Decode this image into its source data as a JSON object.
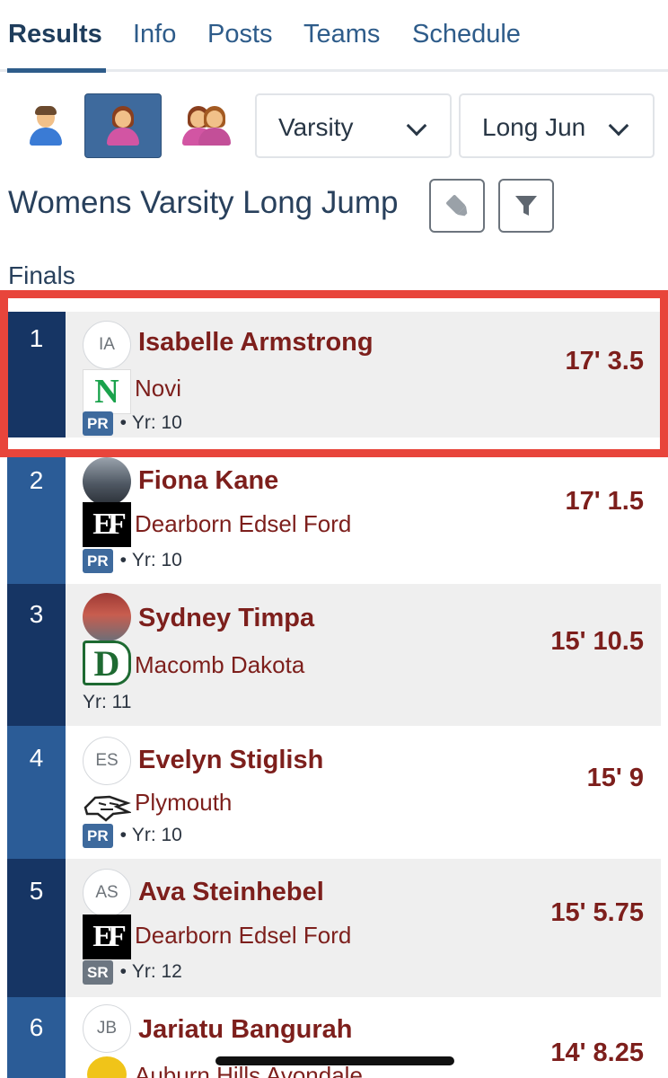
{
  "tabs": [
    {
      "label": "Results",
      "active": true
    },
    {
      "label": "Info",
      "active": false
    },
    {
      "label": "Posts",
      "active": false
    },
    {
      "label": "Teams",
      "active": false
    },
    {
      "label": "Schedule",
      "active": false
    }
  ],
  "filters": {
    "gender_options": [
      {
        "icon": "male-person-icon",
        "active": false
      },
      {
        "icon": "female-person-icon",
        "active": true
      },
      {
        "icon": "two-people-icon",
        "active": false
      }
    ],
    "level_select": "Varsity",
    "event_select": "Long Jun"
  },
  "event_title": "Womens Varsity Long Jump",
  "section_label": "Finals",
  "results": [
    {
      "place": "1",
      "initials": "IA",
      "name": "Isabelle Armstrong",
      "school": "Novi",
      "school_logo": "N",
      "pr": "PR",
      "year": "Yr: 10",
      "mark": "17' 3.5"
    },
    {
      "place": "2",
      "initials": "",
      "name": "Fiona Kane",
      "school": "Dearborn Edsel Ford",
      "school_logo": "EF",
      "pr": "PR",
      "year": "Yr: 10",
      "mark": "17' 1.5"
    },
    {
      "place": "3",
      "initials": "",
      "name": "Sydney Timpa",
      "school": "Macomb Dakota",
      "school_logo": "D",
      "pr": "",
      "year": "Yr: 11",
      "mark": "15' 10.5"
    },
    {
      "place": "4",
      "initials": "ES",
      "name": "Evelyn Stiglish",
      "school": "Plymouth",
      "school_logo": "",
      "pr": "PR",
      "year": "Yr: 10",
      "mark": "15' 9"
    },
    {
      "place": "5",
      "initials": "AS",
      "name": "Ava Steinhebel",
      "school": "Dearborn Edsel Ford",
      "school_logo": "EF",
      "pr": "SR",
      "year": "Yr: 12",
      "mark": "15' 5.75"
    },
    {
      "place": "6",
      "initials": "JB",
      "name": "Jariatu Bangurah",
      "school": "Auburn Hills Avondale",
      "school_logo": "",
      "pr": "",
      "year": "",
      "mark": "14' 8.25"
    }
  ],
  "colors": {
    "accent": "#2e5c8a",
    "rank_bar": "#2b5c97",
    "rank_bar_dark": "#163564",
    "athlete_text": "#7d1f1c",
    "highlight_box": "#e8453b"
  }
}
